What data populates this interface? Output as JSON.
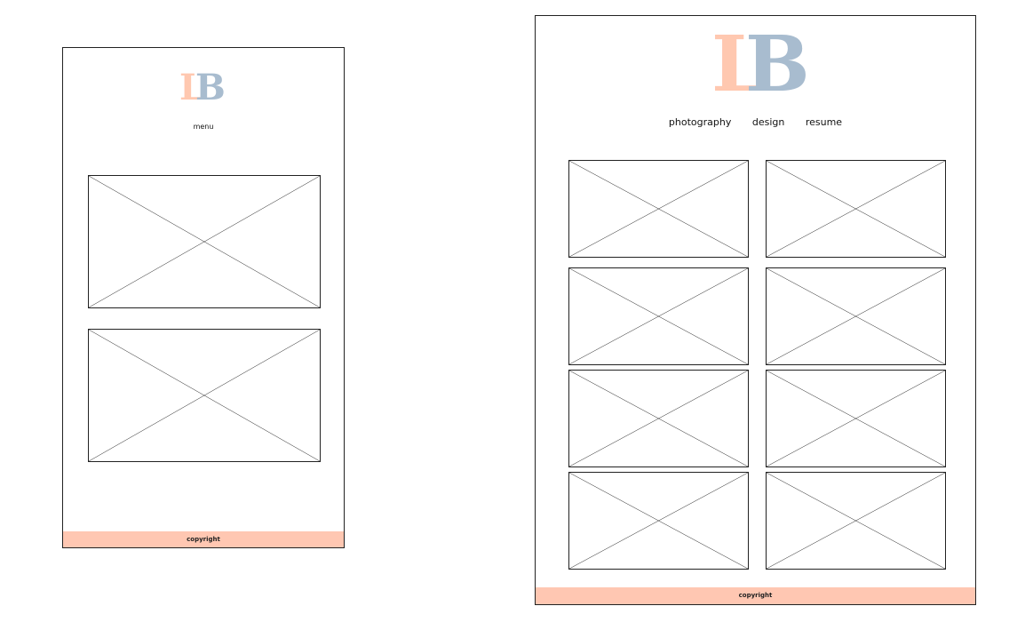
{
  "colors": {
    "logo_l": "#ffc8b0",
    "logo_b": "#a8bccf",
    "footer": "#ffc7b2"
  },
  "mobile": {
    "logo_l": "L",
    "logo_b": "B",
    "menu_label": "menu",
    "footer_text": "copyright",
    "image_placeholders": 2
  },
  "desktop": {
    "logo_l": "L",
    "logo_b": "B",
    "nav": [
      "photography",
      "design",
      "resume"
    ],
    "footer_text": "copyright",
    "image_placeholders": 8
  }
}
